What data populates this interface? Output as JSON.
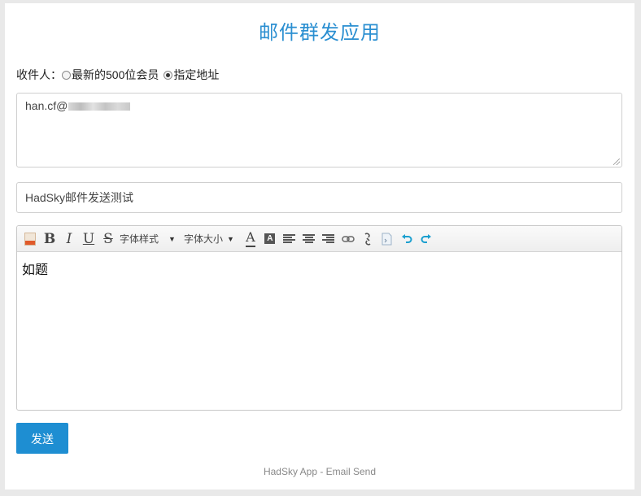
{
  "page": {
    "title": "邮件群发应用",
    "footer": "HadSky App - Email Send"
  },
  "recipients": {
    "label": "收件人：",
    "options": [
      "最新的500位会员",
      "指定地址"
    ],
    "selected_index": 1
  },
  "to_field": {
    "value_visible": "han.cf@"
  },
  "subject_field": {
    "value": "HadSky邮件发送测试"
  },
  "editor": {
    "toolbar": {
      "font_style": "字体样式",
      "font_size": "字体大小",
      "font_color_glyph": "A",
      "bg_color_glyph": "A",
      "bold_glyph": "B",
      "italic_glyph": "I",
      "underline_glyph": "U",
      "strike_glyph": "S",
      "caret": "▼"
    },
    "content": "如题"
  },
  "actions": {
    "send_label": "发送"
  },
  "colors": {
    "accent": "#1e8ed2",
    "title": "#2b8fd1"
  }
}
